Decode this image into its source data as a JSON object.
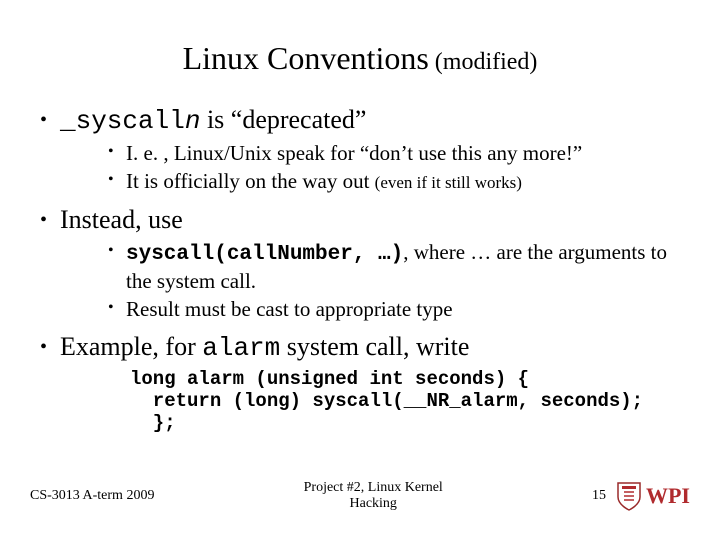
{
  "title_main": "Linux Conventions",
  "title_mod": " (modified)",
  "b1_code": "_syscall",
  "b1_after": " is “deprecated”",
  "b1_codeItalic": "n",
  "b1s1": "I. e. , Linux/Unix speak for “don’t use this any more!”",
  "b1s2_a": "It is officially on the way out ",
  "b1s2_small": "(even if it still works)",
  "b2": "Instead, use",
  "b2s1_code": "syscall(callNumber, …)",
  "b2s1_after": ", where … are the arguments to the system call.",
  "b2s2": "Result must be cast to appropriate type",
  "b3_a": "Example, for ",
  "b3_code": "alarm",
  "b3_b": " system call, write",
  "codeblock": "long alarm (unsigned int seconds) {\n  return (long) syscall(__NR_alarm, seconds);\n  };",
  "footer_left": "CS-3013 A-term 2009",
  "footer_center_l1": "Project #2, Linux Kernel",
  "footer_center_l2": "Hacking",
  "footer_page": "15",
  "logo_text": "WPI"
}
